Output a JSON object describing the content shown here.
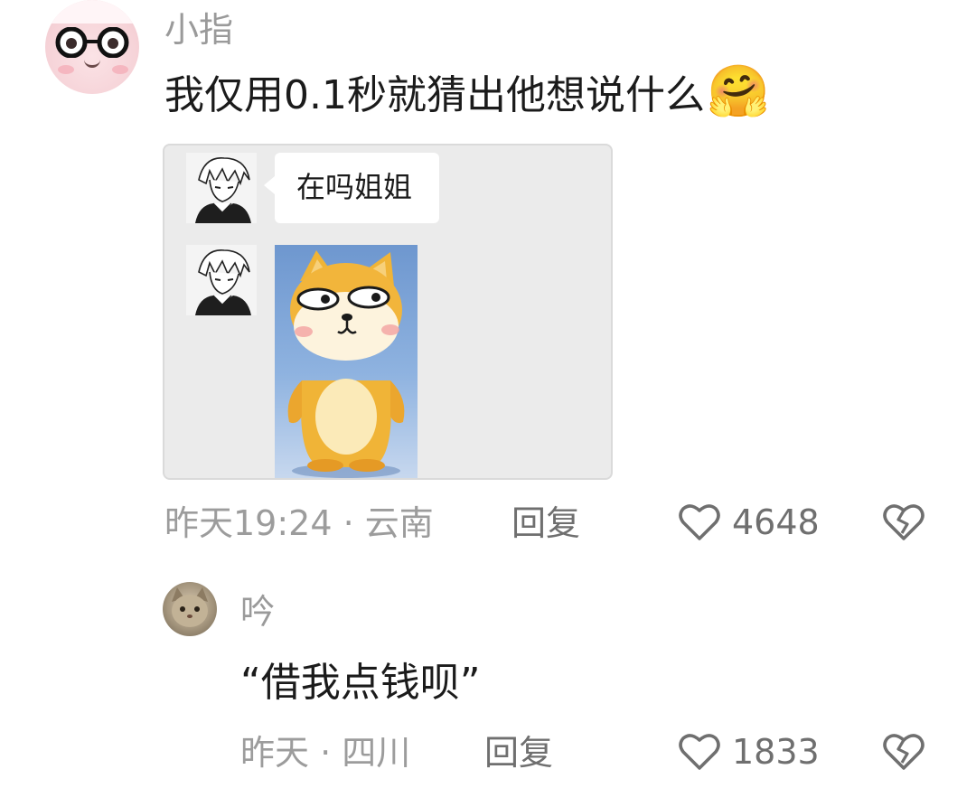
{
  "comments": [
    {
      "username": "小指",
      "text": "我仅用0.1秒就猜出他想说什么",
      "emoji": "🤗",
      "chat": {
        "bubble_text": "在吗姐姐"
      },
      "meta": "昨天19:24 · 云南",
      "reply_label": "回复",
      "likes": "4648"
    },
    {
      "username": "吟",
      "text": "“借我点钱呗”",
      "meta": "昨天 · 四川",
      "reply_label": "回复",
      "likes": "1833"
    }
  ],
  "icons": {
    "like": "heart-icon",
    "dislike": "broken-heart-icon",
    "emoji": "hugging-face-emoji"
  },
  "colors": {
    "username": "#9a9a9a",
    "text": "#1b1b1b",
    "meta": "#9c9c9c",
    "action": "#6f6f6f",
    "chat_bg": "#ebebeb"
  }
}
